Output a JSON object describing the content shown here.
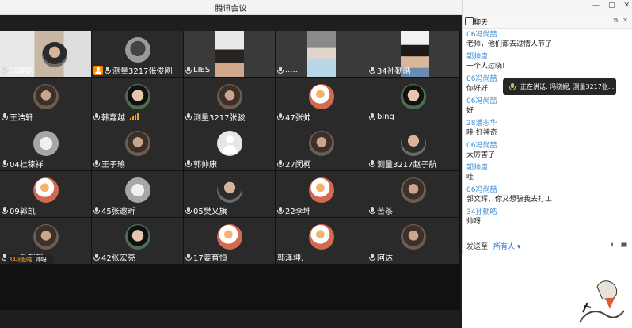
{
  "app": {
    "title": "腾讯会议"
  },
  "window": {
    "controls": [
      "—",
      "▢",
      "✕"
    ]
  },
  "grid": {
    "tiles": [
      {
        "name": "冯晓妮",
        "kind": "video",
        "mic": true
      },
      {
        "name": "测量3217张俊刚",
        "kind": "avatar",
        "host": true,
        "mic": true
      },
      {
        "name": "LIES",
        "kind": "video",
        "mic": true
      },
      {
        "name": "......",
        "kind": "video",
        "mic": true
      },
      {
        "name": "34孙勤皓",
        "kind": "video",
        "mic": true
      },
      {
        "name": "王浩轩",
        "kind": "avatar",
        "mic": true
      },
      {
        "name": "韩嘉越",
        "kind": "avatar",
        "mic": true,
        "signal": true
      },
      {
        "name": "测量3217张骏",
        "kind": "avatar",
        "mic": true
      },
      {
        "name": "47张帅",
        "kind": "avatar",
        "mic": true
      },
      {
        "name": "bing",
        "kind": "avatar",
        "mic": true
      },
      {
        "name": "04杜稼祥",
        "kind": "avatar",
        "mic": true
      },
      {
        "name": "王子瑜",
        "kind": "avatar",
        "mic": true
      },
      {
        "name": "郭帅康",
        "kind": "default",
        "mic": true
      },
      {
        "name": "27闵柯",
        "kind": "avatar",
        "mic": true
      },
      {
        "name": "测量3217赵子航",
        "kind": "avatar",
        "mic": true
      },
      {
        "name": "09郭凯",
        "kind": "avatar",
        "mic": true
      },
      {
        "name": "45张邀昕",
        "kind": "avatar",
        "mic": true
      },
      {
        "name": "05樊又旗",
        "kind": "avatar",
        "mic": true
      },
      {
        "name": "22李坤",
        "kind": "avatar",
        "mic": true
      },
      {
        "name": "苦茶",
        "kind": "avatar",
        "mic": true
      },
      {
        "name": "40岳麒麟",
        "kind": "avatar",
        "mic": true
      },
      {
        "name": "42张宏亮",
        "kind": "avatar",
        "mic": true
      },
      {
        "name": "17姜育恒",
        "kind": "avatar",
        "mic": true
      },
      {
        "name": "郭泽坤.",
        "kind": "avatar",
        "mic": false
      },
      {
        "name": "阿达",
        "kind": "avatar",
        "mic": true
      }
    ]
  },
  "speaking_pill": {
    "who": "34孙勤皓",
    "text": "帅呀"
  },
  "chat": {
    "header": "聊天",
    "messages": [
      {
        "sender": "06冯尚喆",
        "text": "老师，他们都去过情人节了"
      },
      {
        "sender": "郭帅康",
        "text": "一个人过晓!"
      },
      {
        "sender": "06冯尚喆",
        "text": "你好好"
      },
      {
        "sender": "06冯尚喆",
        "text": "好"
      },
      {
        "sender": "28潘志华",
        "text": "哇 好神奇"
      },
      {
        "sender": "06冯尚喆",
        "text": "太厉害了"
      },
      {
        "sender": "郭帅康",
        "text": "哇"
      },
      {
        "sender": "06冯尚喆",
        "text": "郭文辉，你又想骗我去打工"
      },
      {
        "sender": "34孙勤皓",
        "text": "帅呀"
      }
    ],
    "send_to_label": "发送至:",
    "send_to_value": "所有人 ▾"
  },
  "toast": {
    "text": "正在讲话: 冯晓妮; 测量3217张..."
  },
  "colors": {
    "accent": "#3d8bd4",
    "signal": "#ff9c2a",
    "host": "#ff8a00"
  }
}
